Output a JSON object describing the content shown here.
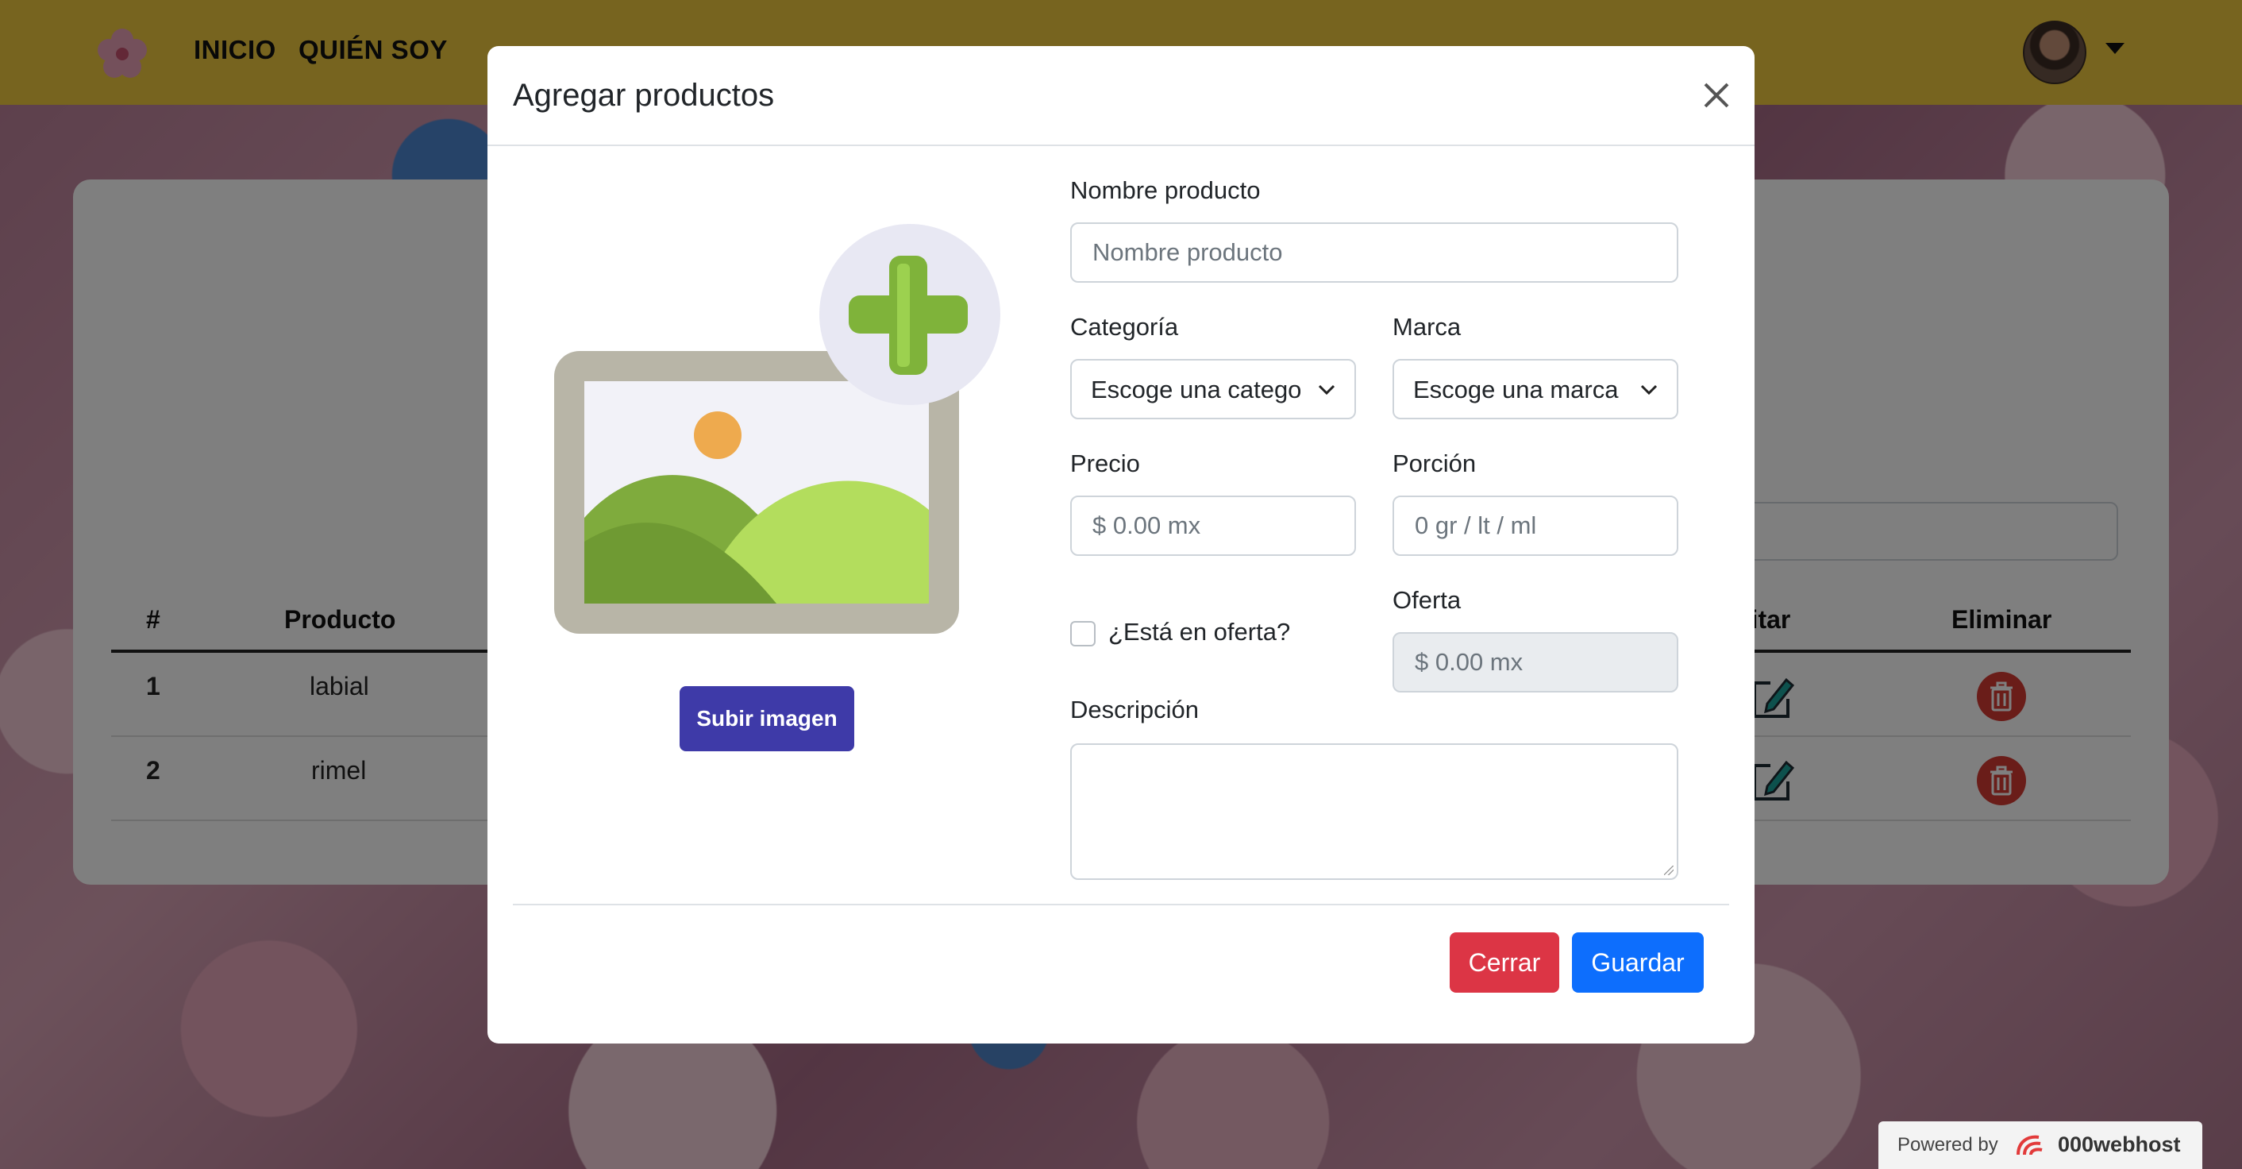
{
  "navbar": {
    "links": [
      "INICIO",
      "QUIÉN SOY"
    ]
  },
  "table": {
    "headers": [
      "#",
      "Producto",
      "ditar",
      "Eliminar"
    ],
    "rows": [
      {
        "num": "1",
        "product": "labial"
      },
      {
        "num": "2",
        "product": "rimel"
      }
    ]
  },
  "modal": {
    "title": "Agregar productos",
    "upload_label": "Subir imagen",
    "nombre": {
      "label": "Nombre producto",
      "placeholder": "Nombre producto"
    },
    "categoria": {
      "label": "Categoría",
      "value": "Escoge una categoría"
    },
    "marca": {
      "label": "Marca",
      "value": "Escoge una marca"
    },
    "precio": {
      "label": "Precio",
      "placeholder": "$ 0.00 mx"
    },
    "porcion": {
      "label": "Porción",
      "placeholder": "0 gr / lt / ml"
    },
    "oferta_check": {
      "label": "¿Está en oferta?",
      "checked": false
    },
    "oferta": {
      "label": "Oferta",
      "placeholder": "$ 0.00 mx"
    },
    "descripcion": {
      "label": "Descripción"
    },
    "close_label": "Cerrar",
    "save_label": "Guardar"
  },
  "footer_badge": {
    "prefix": "Powered by",
    "brand": "000webhost"
  },
  "colors": {
    "navbar": "#efc83e",
    "upload_button": "#3e3aa8",
    "danger": "#dc3545",
    "primary": "#0d6efd",
    "edit_icon": "#1aa39a",
    "delete_icon": "#d43a33"
  }
}
